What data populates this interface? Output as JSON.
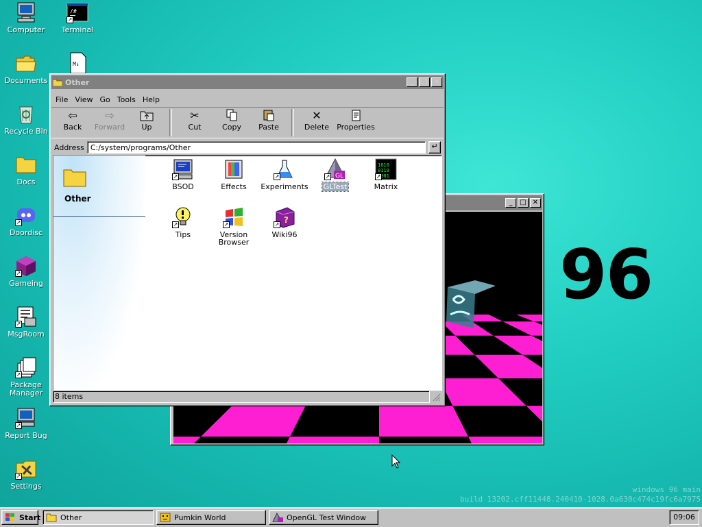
{
  "desktop": {
    "icons": [
      {
        "label": "Computer"
      },
      {
        "label": "Terminal"
      },
      {
        "label": "Documents"
      },
      {
        "label": "Recycle Bin"
      },
      {
        "label": "Docs"
      },
      {
        "label": "Doordisc"
      },
      {
        "label": "Gameing"
      },
      {
        "label": "MsgRoom"
      },
      {
        "label": "Package Manager"
      },
      {
        "label": "Report Bug"
      },
      {
        "label": "Settings"
      }
    ],
    "big_text": "96",
    "watermark_line1": "windows 96 main",
    "watermark_line2": "build 13202.cff11448.240410-1028.0a630c474c19fc6a7975"
  },
  "explorer": {
    "title": "Other",
    "menu": [
      "File",
      "View",
      "Go",
      "Tools",
      "Help"
    ],
    "toolbar": {
      "back": "Back",
      "forward": "Forward",
      "up": "Up",
      "cut": "Cut",
      "copy": "Copy",
      "paste": "Paste",
      "delete": "Delete",
      "properties": "Properties"
    },
    "address_label": "Address",
    "address_value": "C:/system/programs/Other",
    "panel_title": "Other",
    "files": [
      {
        "label": "BSOD",
        "icon": "bsod-icon"
      },
      {
        "label": "Effects",
        "icon": "effects-icon"
      },
      {
        "label": "Experiments",
        "icon": "flask-icon"
      },
      {
        "label": "GLTest",
        "icon": "gltest-icon",
        "selected": true
      },
      {
        "label": "Matrix",
        "icon": "matrix-icon"
      },
      {
        "label": "Tips",
        "icon": "lightbulb-icon"
      },
      {
        "label": "Version Browser",
        "icon": "windows-flag-icon"
      },
      {
        "label": "Wiki96",
        "icon": "help-book-icon"
      }
    ],
    "status": "8 items"
  },
  "taskbar": {
    "start_label": "Start",
    "buttons": [
      {
        "label": "Other"
      },
      {
        "label": "Pumkin World"
      },
      {
        "label": "OpenGL Test Window"
      }
    ],
    "clock": "09:06"
  },
  "colors": {
    "desktop": "#22cfc2",
    "checker_magenta": "#ff1fd2",
    "title_inactive": "#808080"
  }
}
